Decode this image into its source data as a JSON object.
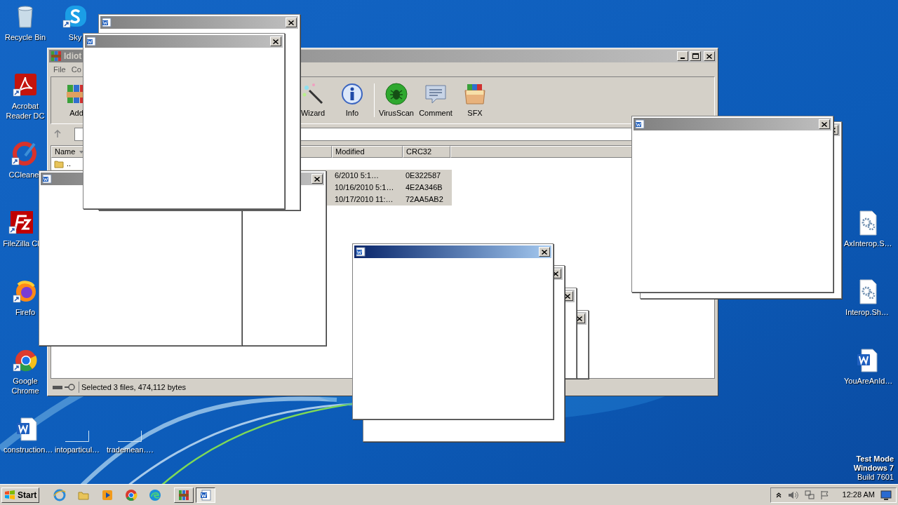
{
  "desktop_icons": [
    {
      "label": "Recycle Bin",
      "kind": "recycle"
    },
    {
      "label": "Sky",
      "kind": "skype"
    },
    {
      "label": "Acrobat Reader DC",
      "kind": "acrobat"
    },
    {
      "label": "CCleane",
      "kind": "ccleaner"
    },
    {
      "label": "FileZilla Cl",
      "kind": "filezilla"
    },
    {
      "label": "Firefo",
      "kind": "firefox"
    },
    {
      "label": "Google Chrome",
      "kind": "chrome"
    },
    {
      "label": "construction…",
      "kind": "word"
    },
    {
      "label": "intoparticul…",
      "kind": "blank"
    },
    {
      "label": "trademean….",
      "kind": "blank"
    },
    {
      "label": "AxInterop.S…",
      "kind": "gear"
    },
    {
      "label": "Interop.Sh…",
      "kind": "gear"
    },
    {
      "label": "YouAreAnId…",
      "kind": "word"
    }
  ],
  "archiver": {
    "title": "Idiot",
    "menu": [
      "File",
      "Co"
    ],
    "toolbar": [
      {
        "label": "Add",
        "kind": "add"
      },
      {
        "label": "Wizard",
        "kind": "wizard"
      },
      {
        "label": "Info",
        "kind": "info"
      },
      {
        "label": "VirusScan",
        "kind": "virusscan"
      },
      {
        "label": "Comment",
        "kind": "comment"
      },
      {
        "label": "SFX",
        "kind": "sfx"
      }
    ],
    "columns": [
      "Name",
      "Modified",
      "CRC32"
    ],
    "rows": [
      {
        "name": "..",
        "selected": false
      },
      {
        "modified": "6/2010 5:1…",
        "crc32": "0E322587",
        "selected": true
      },
      {
        "modified": "10/16/2010 5:1…",
        "crc32": "4E2A346B",
        "selected": true
      },
      {
        "modified": "10/17/2010 11:…",
        "crc32": "72AA5AB2",
        "selected": true
      }
    ],
    "status": "Selected 3 files, 474,112 bytes"
  },
  "popups": [
    {
      "active": false
    },
    {
      "active": false
    },
    {
      "active": false
    },
    {
      "active": false
    },
    {
      "active": false
    },
    {
      "active": false
    },
    {
      "active": false
    },
    {
      "active": true
    },
    {
      "active": false
    },
    {
      "active": false
    }
  ],
  "watermark_text": [
    "Test Mode",
    "Windows 7",
    "Build 7601"
  ],
  "taskbar": {
    "start": "Start",
    "quick_launch": [
      {
        "kind": "ie"
      },
      {
        "kind": "folder"
      },
      {
        "kind": "media"
      },
      {
        "kind": "chrome"
      },
      {
        "kind": "edge"
      }
    ],
    "tasks": [
      {
        "kind": "archiver",
        "selected": false
      },
      {
        "kind": "word",
        "selected": true
      }
    ],
    "clock": "12:28 AM"
  }
}
